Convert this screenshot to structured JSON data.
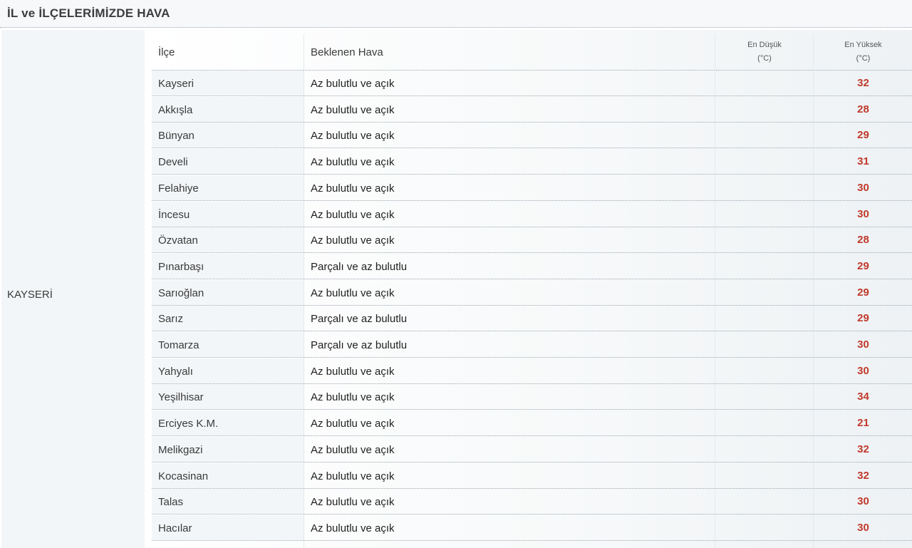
{
  "header": {
    "title": "İL ve İLÇELERİMİZDE HAVA"
  },
  "province": "KAYSERİ",
  "columns": {
    "ilce": "İlçe",
    "hava": "Beklenen Hava",
    "min_line1": "En Düşük",
    "min_line2": "(°C)",
    "max_line1": "En Yüksek",
    "max_line2": "(°C)"
  },
  "rows": [
    {
      "ilce": "Kayseri",
      "hava": "Az bulutlu ve açık",
      "min": "",
      "max": "32"
    },
    {
      "ilce": "Akkışla",
      "hava": "Az bulutlu ve açık",
      "min": "",
      "max": "28"
    },
    {
      "ilce": "Bünyan",
      "hava": "Az bulutlu ve açık",
      "min": "",
      "max": "29"
    },
    {
      "ilce": "Develi",
      "hava": "Az bulutlu ve açık",
      "min": "",
      "max": "31"
    },
    {
      "ilce": "Felahiye",
      "hava": "Az bulutlu ve açık",
      "min": "",
      "max": "30"
    },
    {
      "ilce": "İncesu",
      "hava": "Az bulutlu ve açık",
      "min": "",
      "max": "30"
    },
    {
      "ilce": "Özvatan",
      "hava": "Az bulutlu ve açık",
      "min": "",
      "max": "28"
    },
    {
      "ilce": "Pınarbaşı",
      "hava": "Parçalı ve az bulutlu",
      "min": "",
      "max": "29"
    },
    {
      "ilce": "Sarıoğlan",
      "hava": "Az bulutlu ve açık",
      "min": "",
      "max": "29"
    },
    {
      "ilce": "Sarız",
      "hava": "Parçalı ve az bulutlu",
      "min": "",
      "max": "29"
    },
    {
      "ilce": "Tomarza",
      "hava": "Parçalı ve az bulutlu",
      "min": "",
      "max": "30"
    },
    {
      "ilce": "Yahyalı",
      "hava": "Az bulutlu ve açık",
      "min": "",
      "max": "30"
    },
    {
      "ilce": "Yeşilhisar",
      "hava": "Az bulutlu ve açık",
      "min": "",
      "max": "34"
    },
    {
      "ilce": "Erciyes K.M.",
      "hava": "Az bulutlu ve açık",
      "min": "",
      "max": "21"
    },
    {
      "ilce": "Melikgazi",
      "hava": "Az bulutlu ve açık",
      "min": "",
      "max": "32"
    },
    {
      "ilce": "Kocasinan",
      "hava": "Az bulutlu ve açık",
      "min": "",
      "max": "32"
    },
    {
      "ilce": "Talas",
      "hava": "Az bulutlu ve açık",
      "min": "",
      "max": "30"
    },
    {
      "ilce": "Hacılar",
      "hava": "Az bulutlu ve açık",
      "min": "",
      "max": "30"
    }
  ],
  "colors": {
    "max_temp": "#c0392b",
    "header_bg": "#f6f8fa",
    "cell_bg": "#f3f6f8"
  }
}
